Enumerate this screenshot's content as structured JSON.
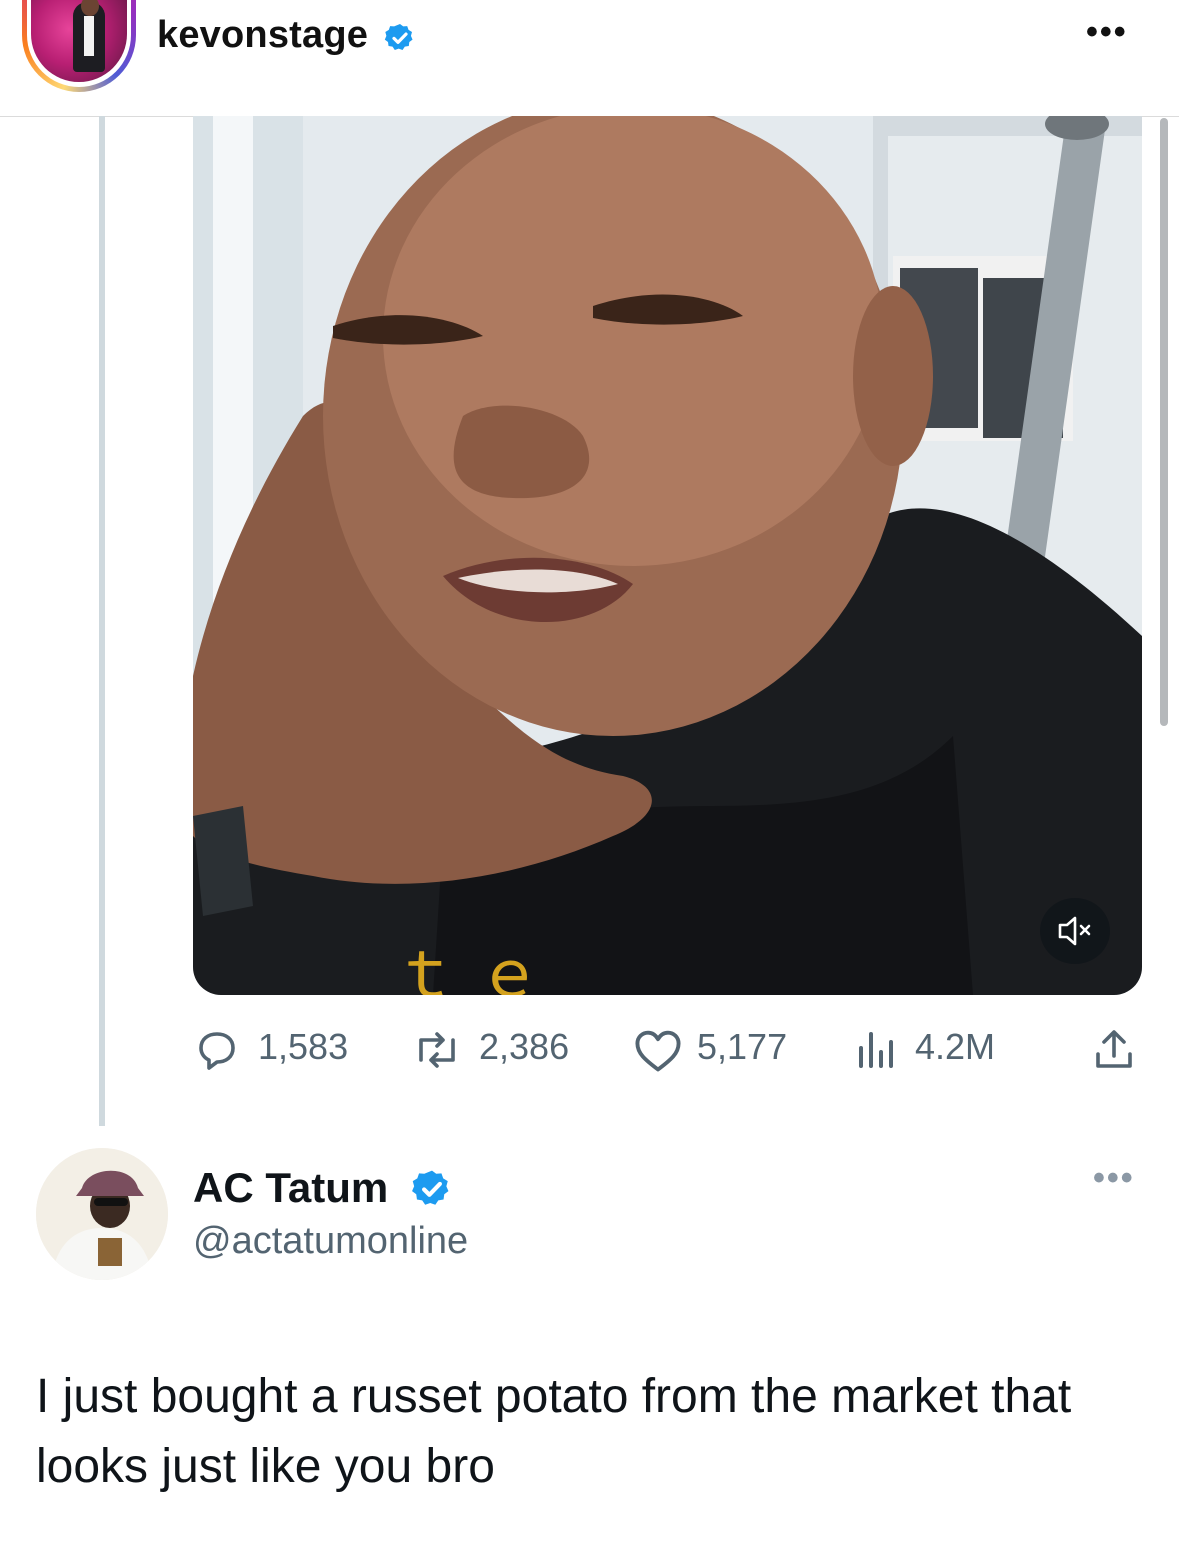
{
  "header": {
    "username": "kevonstage",
    "verified_color": "#1d9bf0",
    "more_icon": "more-horizontal-icon"
  },
  "video": {
    "mute_icon": "speaker-muted-icon"
  },
  "stats": {
    "replies": "1,583",
    "reposts": "2,386",
    "likes": "5,177",
    "views": "4.2M"
  },
  "reply": {
    "name": "AC Tatum",
    "handle": "@actatumonline",
    "text": "I just bought a russet potato from the market that looks just like you bro",
    "verified_color": "#1d9bf0"
  },
  "colors": {
    "secondary_text": "#536471",
    "thread_line": "#cfd9de",
    "instagram_gradient": [
      "#feda75",
      "#fa7e1e",
      "#d62976",
      "#962fbf",
      "#4f5bd5"
    ]
  }
}
